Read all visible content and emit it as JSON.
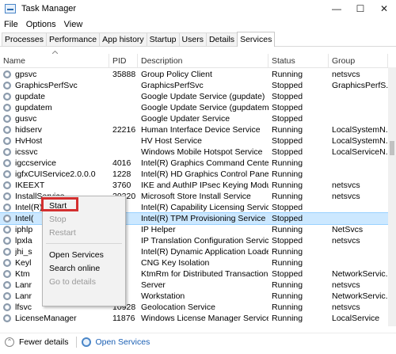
{
  "window": {
    "title": "Task Manager",
    "minimize": "—",
    "maximize": "☐",
    "close": "✕"
  },
  "menu": [
    "File",
    "Options",
    "View"
  ],
  "tabs": [
    "Processes",
    "Performance",
    "App history",
    "Startup",
    "Users",
    "Details",
    "Services"
  ],
  "active_tab": "Services",
  "columns": {
    "name": "Name",
    "pid": "PID",
    "description": "Description",
    "status": "Status",
    "group": "Group"
  },
  "rows": [
    {
      "name": "gpsvc",
      "pid": "35888",
      "description": "Group Policy Client",
      "status": "Running",
      "group": "netsvcs"
    },
    {
      "name": "GraphicsPerfSvc",
      "pid": "",
      "description": "GraphicsPerfSvc",
      "status": "Stopped",
      "group": "GraphicsPerfS..."
    },
    {
      "name": "gupdate",
      "pid": "",
      "description": "Google Update Service (gupdate)",
      "status": "Stopped",
      "group": ""
    },
    {
      "name": "gupdatem",
      "pid": "",
      "description": "Google Update Service (gupdatem)",
      "status": "Stopped",
      "group": ""
    },
    {
      "name": "gusvc",
      "pid": "",
      "description": "Google Updater Service",
      "status": "Stopped",
      "group": ""
    },
    {
      "name": "hidserv",
      "pid": "22216",
      "description": "Human Interface Device Service",
      "status": "Running",
      "group": "LocalSystemN..."
    },
    {
      "name": "HvHost",
      "pid": "",
      "description": "HV Host Service",
      "status": "Stopped",
      "group": "LocalSystemN..."
    },
    {
      "name": "icssvc",
      "pid": "",
      "description": "Windows Mobile Hotspot Service",
      "status": "Stopped",
      "group": "LocalServiceN..."
    },
    {
      "name": "igccservice",
      "pid": "4016",
      "description": "Intel(R) Graphics Command Center ...",
      "status": "Running",
      "group": ""
    },
    {
      "name": "igfxCUIService2.0.0.0",
      "pid": "1228",
      "description": "Intel(R) HD Graphics Control Panel S...",
      "status": "Running",
      "group": ""
    },
    {
      "name": "IKEEXT",
      "pid": "3760",
      "description": "IKE and AuthIP IPsec Keying Modules",
      "status": "Running",
      "group": "netsvcs"
    },
    {
      "name": "InstallService",
      "pid": "29220",
      "description": "Microsoft Store Install Service",
      "status": "Running",
      "group": "netsvcs"
    },
    {
      "name": "Intel(R) Capability Licensin...",
      "pid": "",
      "description": "Intel(R) Capability Licensing Service ...",
      "status": "Stopped",
      "group": ""
    },
    {
      "name": "Intel(",
      "pid": "",
      "description": "Intel(R) TPM Provisioning Service",
      "status": "Stopped",
      "group": "",
      "selected": true
    },
    {
      "name": "iphlp",
      "pid": "",
      "description": "IP Helper",
      "status": "Running",
      "group": "NetSvcs"
    },
    {
      "name": "lpxla",
      "pid": "",
      "description": "IP Translation Configuration Service",
      "status": "Stopped",
      "group": "netsvcs"
    },
    {
      "name": "jhi_s",
      "pid": "",
      "description": "Intel(R) Dynamic Application Loader...",
      "status": "Running",
      "group": ""
    },
    {
      "name": "Keyl",
      "pid": "",
      "description": "CNG Key Isolation",
      "status": "Running",
      "group": ""
    },
    {
      "name": "Ktm",
      "pid": "",
      "description": "KtmRm for Distributed Transaction C...",
      "status": "Stopped",
      "group": "NetworkServic..."
    },
    {
      "name": "Lanr",
      "pid": "",
      "description": "Server",
      "status": "Running",
      "group": "netsvcs"
    },
    {
      "name": "Lanr",
      "pid": "",
      "description": "Workstation",
      "status": "Running",
      "group": "NetworkServic..."
    },
    {
      "name": "lfsvc",
      "pid": "10928",
      "description": "Geolocation Service",
      "status": "Running",
      "group": "netsvcs"
    },
    {
      "name": "LicenseManager",
      "pid": "11876",
      "description": "Windows License Manager Service",
      "status": "Running",
      "group": "LocalService"
    }
  ],
  "context_menu": {
    "start": "Start",
    "stop": "Stop",
    "restart": "Restart",
    "open_services": "Open Services",
    "search_online": "Search online",
    "go_to_details": "Go to details"
  },
  "footer": {
    "fewer_details": "Fewer details",
    "open_services": "Open Services"
  },
  "colors": {
    "selection": "#cce8ff",
    "highlight_box": "#d32f2f",
    "link": "#1a5fb4"
  }
}
